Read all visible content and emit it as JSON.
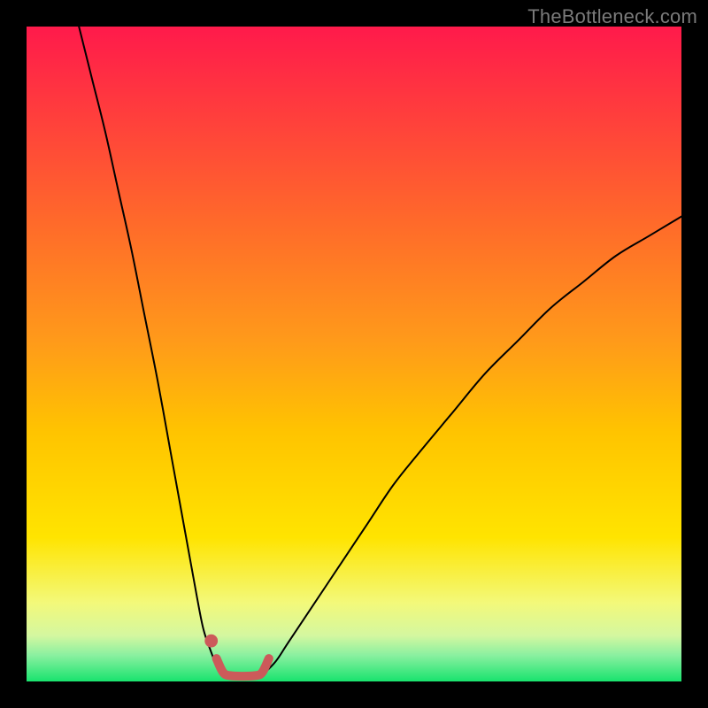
{
  "watermark": "TheBottleneck.com",
  "chart_data": {
    "type": "line",
    "title": "",
    "xlabel": "",
    "ylabel": "",
    "xlim": [
      0,
      100
    ],
    "ylim": [
      0,
      100
    ],
    "grid": false,
    "background_gradient": {
      "top_color": "#ff1a4b",
      "mid_color": "#ffd400",
      "bottom_band_color": "#19e36e"
    },
    "series": [
      {
        "name": "left-branch",
        "stroke": "#000000",
        "stroke_width": 2,
        "x": [
          8,
          10,
          12,
          14,
          16,
          18,
          20,
          22,
          24,
          26,
          27,
          28,
          29,
          30
        ],
        "y": [
          100,
          92,
          84,
          75,
          66,
          56,
          46,
          35,
          24,
          13,
          8,
          5,
          2.5,
          1
        ]
      },
      {
        "name": "right-branch",
        "stroke": "#000000",
        "stroke_width": 2,
        "x": [
          36,
          38,
          40,
          44,
          48,
          52,
          56,
          60,
          65,
          70,
          75,
          80,
          85,
          90,
          95,
          100
        ],
        "y": [
          1,
          3,
          6,
          12,
          18,
          24,
          30,
          35,
          41,
          47,
          52,
          57,
          61,
          65,
          68,
          71
        ]
      },
      {
        "name": "valley-marker",
        "stroke": "#cc5a5a",
        "stroke_width": 10,
        "x": [
          29,
          30,
          31,
          33,
          35,
          36,
          37
        ],
        "y": [
          3.5,
          1.4,
          0.9,
          0.8,
          0.9,
          1.4,
          3.5
        ]
      }
    ],
    "annotations": [
      {
        "name": "valley-dot",
        "shape": "circle",
        "x": 28.2,
        "y": 6.2,
        "r": 1.0,
        "fill": "#cc5a5a"
      }
    ]
  }
}
